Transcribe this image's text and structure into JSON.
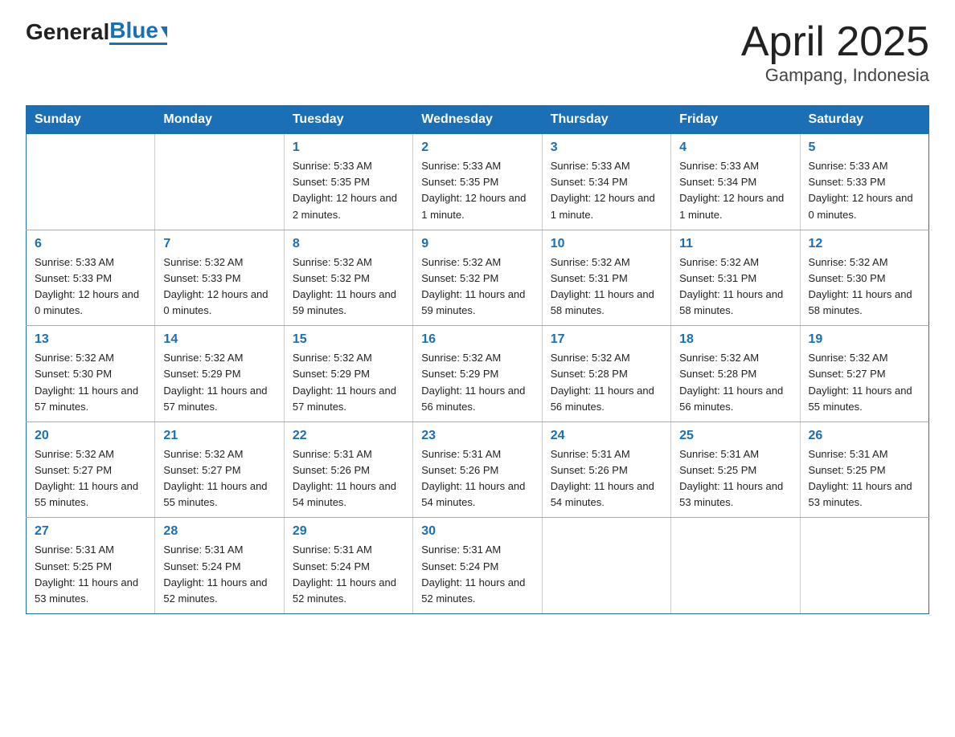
{
  "header": {
    "title": "April 2025",
    "subtitle": "Gampang, Indonesia"
  },
  "logo": {
    "part1": "General",
    "part2": "Blue"
  },
  "weekdays": [
    "Sunday",
    "Monday",
    "Tuesday",
    "Wednesday",
    "Thursday",
    "Friday",
    "Saturday"
  ],
  "weeks": [
    [
      {
        "day": "",
        "sunrise": "",
        "sunset": "",
        "daylight": ""
      },
      {
        "day": "",
        "sunrise": "",
        "sunset": "",
        "daylight": ""
      },
      {
        "day": "1",
        "sunrise": "Sunrise: 5:33 AM",
        "sunset": "Sunset: 5:35 PM",
        "daylight": "Daylight: 12 hours and 2 minutes."
      },
      {
        "day": "2",
        "sunrise": "Sunrise: 5:33 AM",
        "sunset": "Sunset: 5:35 PM",
        "daylight": "Daylight: 12 hours and 1 minute."
      },
      {
        "day": "3",
        "sunrise": "Sunrise: 5:33 AM",
        "sunset": "Sunset: 5:34 PM",
        "daylight": "Daylight: 12 hours and 1 minute."
      },
      {
        "day": "4",
        "sunrise": "Sunrise: 5:33 AM",
        "sunset": "Sunset: 5:34 PM",
        "daylight": "Daylight: 12 hours and 1 minute."
      },
      {
        "day": "5",
        "sunrise": "Sunrise: 5:33 AM",
        "sunset": "Sunset: 5:33 PM",
        "daylight": "Daylight: 12 hours and 0 minutes."
      }
    ],
    [
      {
        "day": "6",
        "sunrise": "Sunrise: 5:33 AM",
        "sunset": "Sunset: 5:33 PM",
        "daylight": "Daylight: 12 hours and 0 minutes."
      },
      {
        "day": "7",
        "sunrise": "Sunrise: 5:32 AM",
        "sunset": "Sunset: 5:33 PM",
        "daylight": "Daylight: 12 hours and 0 minutes."
      },
      {
        "day": "8",
        "sunrise": "Sunrise: 5:32 AM",
        "sunset": "Sunset: 5:32 PM",
        "daylight": "Daylight: 11 hours and 59 minutes."
      },
      {
        "day": "9",
        "sunrise": "Sunrise: 5:32 AM",
        "sunset": "Sunset: 5:32 PM",
        "daylight": "Daylight: 11 hours and 59 minutes."
      },
      {
        "day": "10",
        "sunrise": "Sunrise: 5:32 AM",
        "sunset": "Sunset: 5:31 PM",
        "daylight": "Daylight: 11 hours and 58 minutes."
      },
      {
        "day": "11",
        "sunrise": "Sunrise: 5:32 AM",
        "sunset": "Sunset: 5:31 PM",
        "daylight": "Daylight: 11 hours and 58 minutes."
      },
      {
        "day": "12",
        "sunrise": "Sunrise: 5:32 AM",
        "sunset": "Sunset: 5:30 PM",
        "daylight": "Daylight: 11 hours and 58 minutes."
      }
    ],
    [
      {
        "day": "13",
        "sunrise": "Sunrise: 5:32 AM",
        "sunset": "Sunset: 5:30 PM",
        "daylight": "Daylight: 11 hours and 57 minutes."
      },
      {
        "day": "14",
        "sunrise": "Sunrise: 5:32 AM",
        "sunset": "Sunset: 5:29 PM",
        "daylight": "Daylight: 11 hours and 57 minutes."
      },
      {
        "day": "15",
        "sunrise": "Sunrise: 5:32 AM",
        "sunset": "Sunset: 5:29 PM",
        "daylight": "Daylight: 11 hours and 57 minutes."
      },
      {
        "day": "16",
        "sunrise": "Sunrise: 5:32 AM",
        "sunset": "Sunset: 5:29 PM",
        "daylight": "Daylight: 11 hours and 56 minutes."
      },
      {
        "day": "17",
        "sunrise": "Sunrise: 5:32 AM",
        "sunset": "Sunset: 5:28 PM",
        "daylight": "Daylight: 11 hours and 56 minutes."
      },
      {
        "day": "18",
        "sunrise": "Sunrise: 5:32 AM",
        "sunset": "Sunset: 5:28 PM",
        "daylight": "Daylight: 11 hours and 56 minutes."
      },
      {
        "day": "19",
        "sunrise": "Sunrise: 5:32 AM",
        "sunset": "Sunset: 5:27 PM",
        "daylight": "Daylight: 11 hours and 55 minutes."
      }
    ],
    [
      {
        "day": "20",
        "sunrise": "Sunrise: 5:32 AM",
        "sunset": "Sunset: 5:27 PM",
        "daylight": "Daylight: 11 hours and 55 minutes."
      },
      {
        "day": "21",
        "sunrise": "Sunrise: 5:32 AM",
        "sunset": "Sunset: 5:27 PM",
        "daylight": "Daylight: 11 hours and 55 minutes."
      },
      {
        "day": "22",
        "sunrise": "Sunrise: 5:31 AM",
        "sunset": "Sunset: 5:26 PM",
        "daylight": "Daylight: 11 hours and 54 minutes."
      },
      {
        "day": "23",
        "sunrise": "Sunrise: 5:31 AM",
        "sunset": "Sunset: 5:26 PM",
        "daylight": "Daylight: 11 hours and 54 minutes."
      },
      {
        "day": "24",
        "sunrise": "Sunrise: 5:31 AM",
        "sunset": "Sunset: 5:26 PM",
        "daylight": "Daylight: 11 hours and 54 minutes."
      },
      {
        "day": "25",
        "sunrise": "Sunrise: 5:31 AM",
        "sunset": "Sunset: 5:25 PM",
        "daylight": "Daylight: 11 hours and 53 minutes."
      },
      {
        "day": "26",
        "sunrise": "Sunrise: 5:31 AM",
        "sunset": "Sunset: 5:25 PM",
        "daylight": "Daylight: 11 hours and 53 minutes."
      }
    ],
    [
      {
        "day": "27",
        "sunrise": "Sunrise: 5:31 AM",
        "sunset": "Sunset: 5:25 PM",
        "daylight": "Daylight: 11 hours and 53 minutes."
      },
      {
        "day": "28",
        "sunrise": "Sunrise: 5:31 AM",
        "sunset": "Sunset: 5:24 PM",
        "daylight": "Daylight: 11 hours and 52 minutes."
      },
      {
        "day": "29",
        "sunrise": "Sunrise: 5:31 AM",
        "sunset": "Sunset: 5:24 PM",
        "daylight": "Daylight: 11 hours and 52 minutes."
      },
      {
        "day": "30",
        "sunrise": "Sunrise: 5:31 AM",
        "sunset": "Sunset: 5:24 PM",
        "daylight": "Daylight: 11 hours and 52 minutes."
      },
      {
        "day": "",
        "sunrise": "",
        "sunset": "",
        "daylight": ""
      },
      {
        "day": "",
        "sunrise": "",
        "sunset": "",
        "daylight": ""
      },
      {
        "day": "",
        "sunrise": "",
        "sunset": "",
        "daylight": ""
      }
    ]
  ]
}
